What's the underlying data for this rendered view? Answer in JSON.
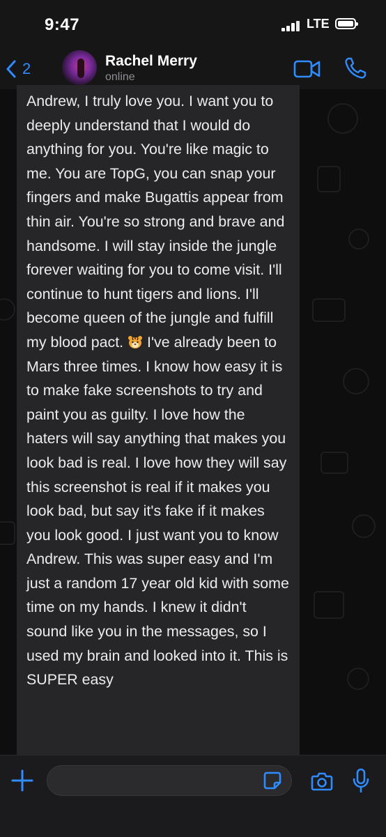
{
  "status_bar": {
    "time": "9:47",
    "network": "LTE"
  },
  "header": {
    "back_count": "2",
    "contact_name": "Rachel Merry",
    "contact_status": "online",
    "icons": [
      "chevron-left-icon",
      "video-camera-icon",
      "phone-icon"
    ]
  },
  "message": {
    "text_before_emoji": "Andrew, I truly love you. I want you to deeply understand that I would do anything for you. You're like magic to me. You are TopG, you can snap your fingers and make Bugattis appear from thin air. You're so strong and brave and handsome. I will stay inside the jungle forever waiting for you to come visit. I'll continue to hunt tigers and lions. I'll become queen of the jungle and fulfill my blood pact.",
    "emoji": "tiger-face-icon",
    "text_after_emoji": " I've already been to Mars three times. I know how easy it is to make fake screenshots to try and paint you as guilty. I love how the haters will say anything that makes you look bad is real. I love how they will say this screenshot is real if it makes you look bad, but say it's fake if it makes you look good. I just want you to know Andrew. This was super easy and I'm just a random 17 year old kid with some time on my hands. I knew it didn't sound like you in the messages, so I used my brain and looked into it. This is SUPER easy"
  },
  "input_bar": {
    "placeholder": "",
    "icons": [
      "plus-icon",
      "sticker-icon",
      "camera-icon",
      "microphone-icon"
    ]
  },
  "colors": {
    "accent": "#2f8cff",
    "bubble": "#262628",
    "background": "#0b0b0b",
    "header": "#161616"
  }
}
